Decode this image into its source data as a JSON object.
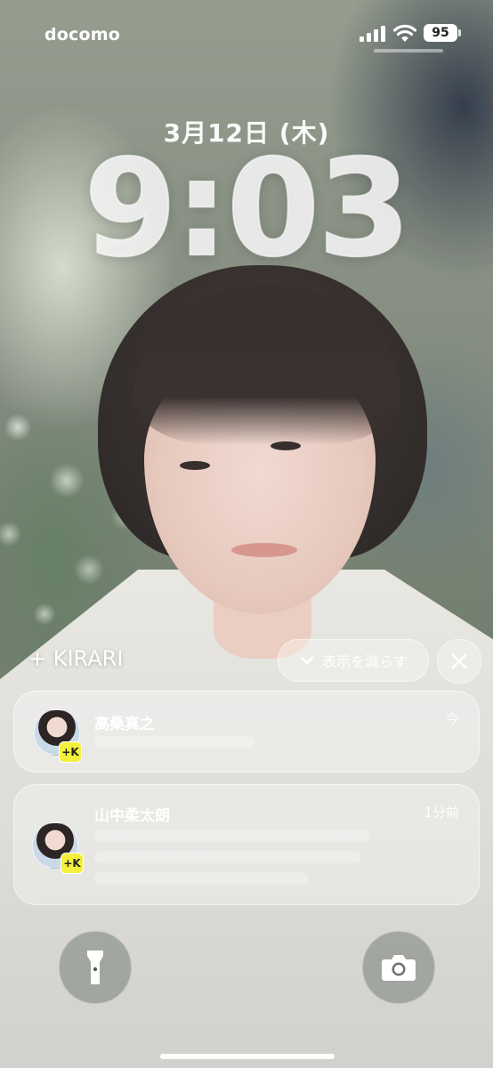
{
  "status_bar": {
    "carrier": "docomo",
    "battery": "95",
    "icons": [
      "signal-icon",
      "wifi-icon",
      "battery-icon"
    ]
  },
  "lock_screen": {
    "date": "3月12日 (木)",
    "time": "9:03"
  },
  "notification_stack": {
    "title": "+ KIRARI",
    "show_less_label": "表示を減らす",
    "icons": [
      "chevron-down-icon",
      "close-icon"
    ],
    "notifications": [
      {
        "sender": "高桑真之",
        "time": "今",
        "app_badge": "+K"
      },
      {
        "sender": "山中柔太朗",
        "time": "1分前",
        "app_badge": "+K"
      }
    ]
  },
  "quick_actions": {
    "left": "flashlight-icon",
    "right": "camera-icon"
  },
  "colors": {
    "badge_yellow": "#f3ef3c",
    "glass": "rgba(255,255,255,0.32)"
  }
}
